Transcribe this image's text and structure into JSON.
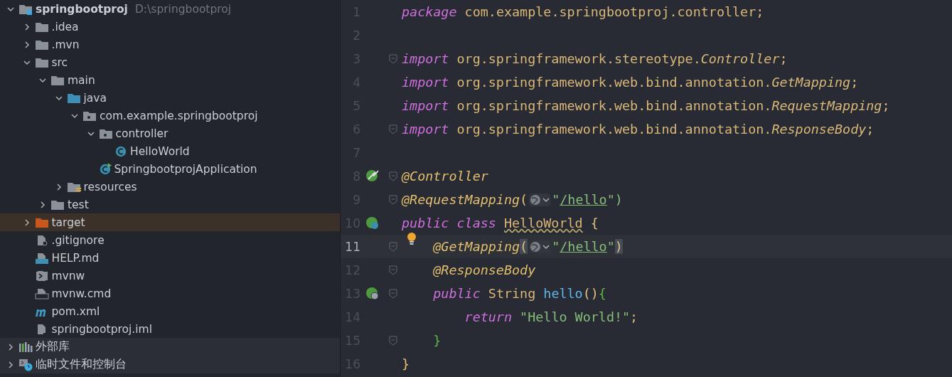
{
  "project_tree": [
    {
      "label": "springbootproj",
      "path": "D:\\springbootproj",
      "kind": "project",
      "expanded": true,
      "selected": false,
      "children": [
        {
          "label": ".idea",
          "kind": "folder",
          "expanded": false,
          "selected": false
        },
        {
          "label": ".mvn",
          "kind": "folder",
          "expanded": false,
          "selected": false
        },
        {
          "label": "src",
          "kind": "folder",
          "expanded": true,
          "selected": false,
          "children": [
            {
              "label": "main",
              "kind": "folder",
              "expanded": true,
              "selected": false,
              "children": [
                {
                  "label": "java",
                  "kind": "source-folder",
                  "expanded": true,
                  "selected": false,
                  "children": [
                    {
                      "label": "com.example.springbootproj",
                      "kind": "package",
                      "expanded": true,
                      "selected": false,
                      "children": [
                        {
                          "label": "controller",
                          "kind": "package",
                          "expanded": true,
                          "selected": false,
                          "children": [
                            {
                              "label": "HelloWorld",
                              "kind": "class",
                              "selected": false
                            }
                          ]
                        },
                        {
                          "label": "SpringbootprojApplication",
                          "kind": "app-class",
                          "selected": false
                        }
                      ]
                    }
                  ]
                },
                {
                  "label": "resources",
                  "kind": "resources-folder",
                  "expanded": false,
                  "selected": false
                }
              ]
            },
            {
              "label": "test",
              "kind": "folder",
              "expanded": false,
              "selected": false
            }
          ]
        },
        {
          "label": "target",
          "kind": "excluded-folder",
          "expanded": false,
          "selected": true
        },
        {
          "label": ".gitignore",
          "kind": "ignore-file",
          "selected": false
        },
        {
          "label": "HELP.md",
          "kind": "md-file",
          "selected": false
        },
        {
          "label": "mvnw",
          "kind": "shell-file",
          "selected": false
        },
        {
          "label": "mvnw.cmd",
          "kind": "cmd-file",
          "selected": false
        },
        {
          "label": "pom.xml",
          "kind": "maven-file",
          "selected": false
        },
        {
          "label": "springbootproj.iml",
          "kind": "iml-file",
          "selected": false
        }
      ]
    },
    {
      "label": "外部库",
      "kind": "libraries",
      "expanded": false,
      "selected": false
    },
    {
      "label": "临时文件和控制台",
      "kind": "scratches",
      "expanded": false,
      "selected": false
    }
  ],
  "editor": {
    "lines": [
      {
        "number": "1",
        "tokens": [
          {
            "text": "package",
            "kind": "keyword"
          },
          {
            "text": " com.example.springbootproj.controller;",
            "kind": "plain"
          }
        ]
      },
      {
        "number": "2"
      },
      {
        "number": "3",
        "fold": true,
        "tokens": [
          {
            "text": "import",
            "kind": "keyword"
          },
          {
            "text": " org.springframework.stereotype.",
            "kind": "plain"
          },
          {
            "text": "Controller",
            "kind": "type"
          },
          {
            "text": ";",
            "kind": "plain"
          }
        ]
      },
      {
        "number": "4",
        "tokens": [
          {
            "text": "import",
            "kind": "keyword"
          },
          {
            "text": " org.springframework.web.bind.annotation.",
            "kind": "plain"
          },
          {
            "text": "GetMapping",
            "kind": "type"
          },
          {
            "text": ";",
            "kind": "plain"
          }
        ]
      },
      {
        "number": "5",
        "tokens": [
          {
            "text": "import",
            "kind": "keyword"
          },
          {
            "text": " org.springframework.web.bind.annotation.",
            "kind": "plain"
          },
          {
            "text": "RequestMapping",
            "kind": "type"
          },
          {
            "text": ";",
            "kind": "plain"
          }
        ]
      },
      {
        "number": "6",
        "fold": true,
        "tokens": [
          {
            "text": "import",
            "kind": "keyword"
          },
          {
            "text": " org.springframework.web.bind.annotation.",
            "kind": "plain"
          },
          {
            "text": "ResponseBody",
            "kind": "type"
          },
          {
            "text": ";",
            "kind": "plain"
          }
        ]
      },
      {
        "number": "7"
      },
      {
        "number": "8",
        "kind": "bean",
        "fold": true,
        "tokens": [
          {
            "text": "@Controller",
            "kind": "annotation"
          }
        ]
      },
      {
        "number": "9",
        "fold": true,
        "tokens": [
          {
            "text": "@RequestMapping",
            "kind": "annotation"
          },
          {
            "text": "(",
            "kind": "paren"
          },
          {
            "kind": "inlay"
          },
          {
            "text": "\"",
            "kind": "string"
          },
          {
            "text": "/hello",
            "kind": "url"
          },
          {
            "text": "\")",
            "kind": "string"
          }
        ]
      },
      {
        "number": "10",
        "kind": "class-bean",
        "tokens": [
          {
            "text": "public class ",
            "kind": "keyword"
          },
          {
            "text": "HelloWorld",
            "kind": "warning"
          },
          {
            "text": " {",
            "kind": "paren"
          }
        ]
      },
      {
        "number": "11",
        "current": true,
        "bulb": true,
        "fold": true,
        "tokens": [
          {
            "text": "    @GetMapping",
            "kind": "annotation"
          },
          {
            "text": "(",
            "kind": "paren-match"
          },
          {
            "kind": "inlay"
          },
          {
            "text": "\"",
            "kind": "string"
          },
          {
            "text": "/hello",
            "kind": "url"
          },
          {
            "text": "\"",
            "kind": "string"
          },
          {
            "text": ")",
            "kind": "paren-match"
          }
        ]
      },
      {
        "number": "12",
        "fold": true,
        "tokens": [
          {
            "text": "    @ResponseBody",
            "kind": "annotation"
          }
        ]
      },
      {
        "number": "13",
        "kind": "web",
        "fold": true,
        "tokens": [
          {
            "text": "    public",
            "kind": "keyword"
          },
          {
            "text": " String ",
            "kind": "plain"
          },
          {
            "text": "hello",
            "kind": "method"
          },
          {
            "text": "()",
            "kind": "paren"
          },
          {
            "text": "{",
            "kind": "brace"
          }
        ]
      },
      {
        "number": "14",
        "tokens": [
          {
            "text": "        return",
            "kind": "keyword"
          },
          {
            "text": " \"Hello World!\"",
            "kind": "string"
          },
          {
            "text": ";",
            "kind": "plain"
          }
        ]
      },
      {
        "number": "15",
        "fold": true,
        "tokens": [
          {
            "text": "    }",
            "kind": "brace"
          }
        ]
      },
      {
        "number": "16",
        "tokens": [
          {
            "text": "}",
            "kind": "paren"
          }
        ]
      }
    ]
  }
}
